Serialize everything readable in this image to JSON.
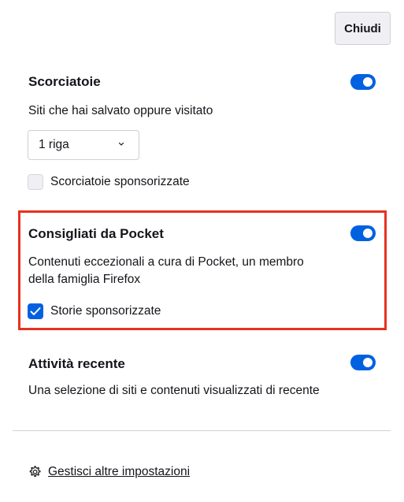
{
  "close_label": "Chiudi",
  "sections": {
    "shortcuts": {
      "title": "Scorciatoie",
      "enabled": true,
      "description": "Siti che hai salvato oppure visitato",
      "rows_select": {
        "selected": "1 riga"
      },
      "sponsored_checkbox": {
        "label": "Scorciatoie sponsorizzate",
        "checked": false
      }
    },
    "pocket": {
      "title": "Consigliati da Pocket",
      "enabled": true,
      "description_line1": "Contenuti eccezionali a cura di Pocket, un membro",
      "description_line2": "della famiglia Firefox",
      "sponsored_checkbox": {
        "label": "Storie sponsorizzate",
        "checked": true
      }
    },
    "recent_activity": {
      "title": "Attività recente",
      "enabled": true,
      "description": "Una selezione di siti e contenuti visualizzati di recente"
    }
  },
  "manage_link": {
    "label": "Gestisci altre impostazioni",
    "icon": "gear-icon"
  },
  "colors": {
    "accent": "#0061e0",
    "highlight": "#e8311f"
  }
}
